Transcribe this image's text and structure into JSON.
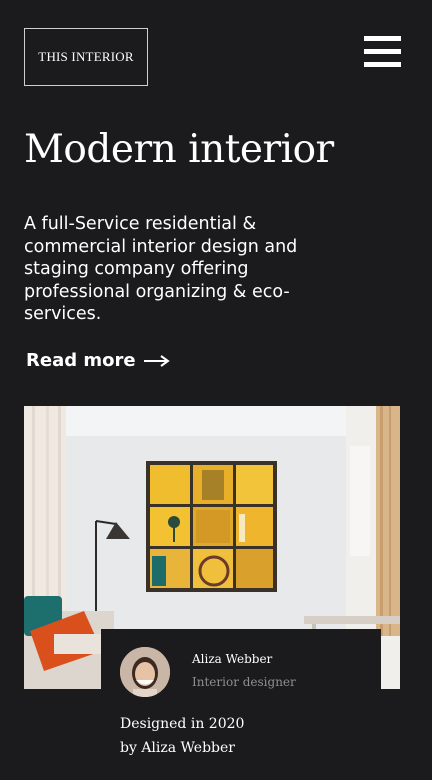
{
  "header": {
    "logo_text": "THIS INTERIOR",
    "menu_icon": "hamburger-menu-icon"
  },
  "hero": {
    "title": "Modern interior",
    "description": "A full-Service residential & commercial interior design and staging company offering professional organizing & eco-services.",
    "read_more_label": "Read more",
    "read_more_icon": "arrow-right-icon"
  },
  "feature": {
    "image_alt": "Living room with a yellow tiled wall art, a floor lamp and a sofa with orange pillows",
    "designer": {
      "name": "Aliza Webber",
      "role": "Interior designer"
    },
    "credit_line1": "Designed in 2020",
    "credit_line2": "by Aliza Webber"
  },
  "colors": {
    "background": "#1b1a1c",
    "text": "#ffffff",
    "muted": "#8f8f8f"
  }
}
